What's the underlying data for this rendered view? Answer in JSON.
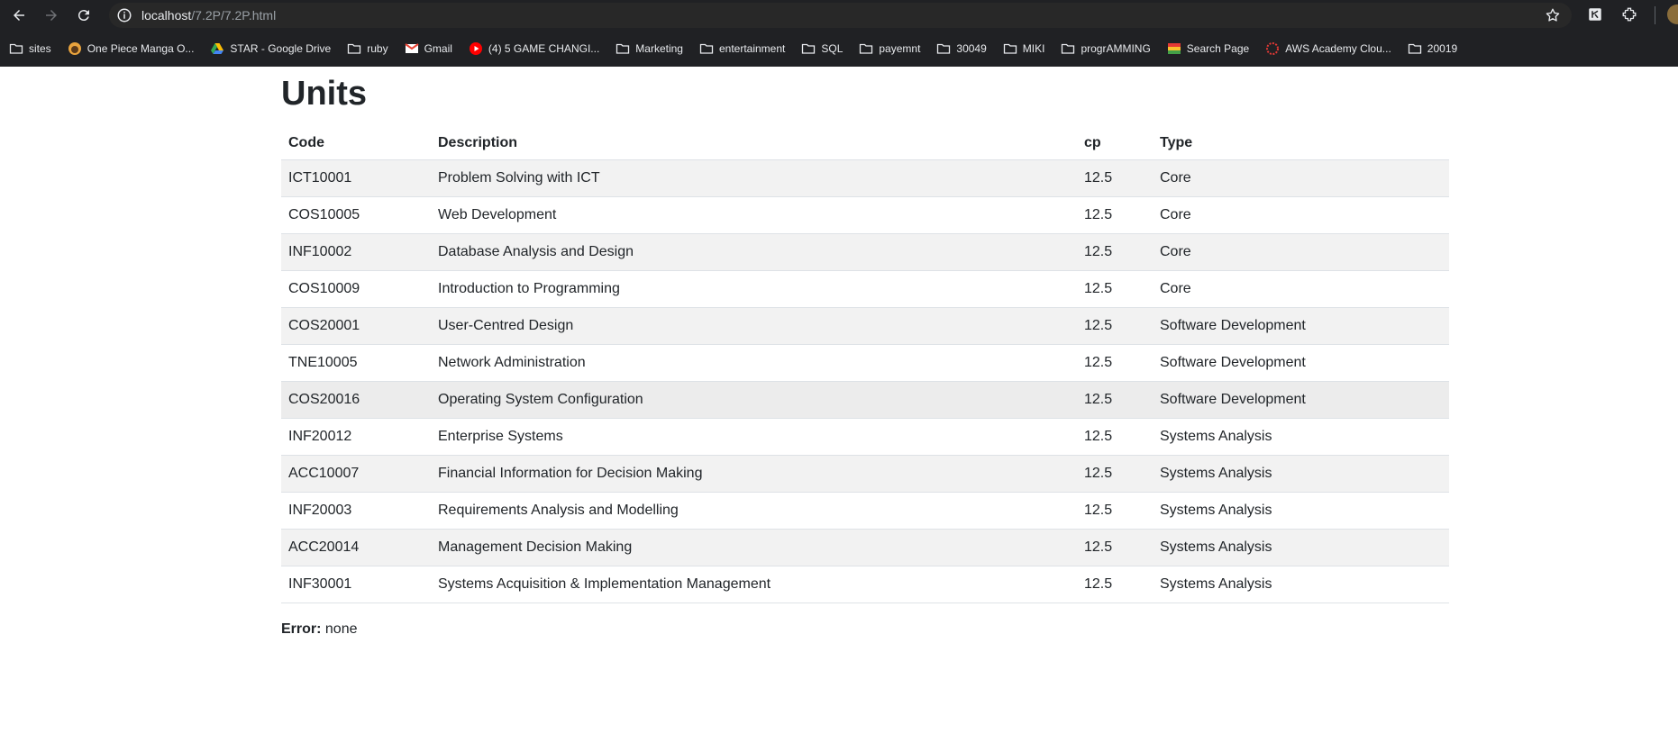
{
  "browser": {
    "url_host": "localhost",
    "url_path": "/7.2P/7.2P.html",
    "bookmarks": [
      {
        "label": "sites",
        "icon": "folder-icon"
      },
      {
        "label": "One Piece Manga O...",
        "icon": "manga-favicon"
      },
      {
        "label": "STAR - Google Drive",
        "icon": "google-drive-icon"
      },
      {
        "label": "ruby",
        "icon": "folder-icon"
      },
      {
        "label": "Gmail",
        "icon": "gmail-icon"
      },
      {
        "label": "(4) 5 GAME CHANGI...",
        "icon": "youtube-icon"
      },
      {
        "label": "Marketing",
        "icon": "folder-icon"
      },
      {
        "label": "entertainment",
        "icon": "folder-icon"
      },
      {
        "label": "SQL",
        "icon": "folder-icon"
      },
      {
        "label": "payemnt",
        "icon": "folder-icon"
      },
      {
        "label": "30049",
        "icon": "folder-icon"
      },
      {
        "label": "MIKI",
        "icon": "folder-icon"
      },
      {
        "label": "progrAMMING",
        "icon": "folder-icon"
      },
      {
        "label": "Search Page",
        "icon": "search-page-favicon"
      },
      {
        "label": "AWS Academy Clou...",
        "icon": "aws-favicon"
      },
      {
        "label": "20019",
        "icon": "folder-icon"
      }
    ]
  },
  "page": {
    "title": "Units",
    "headers": {
      "code": "Code",
      "description": "Description",
      "cp": "cp",
      "type": "Type"
    },
    "rows": [
      {
        "code": "ICT10001",
        "description": "Problem Solving with ICT",
        "cp": "12.5",
        "type": "Core"
      },
      {
        "code": "COS10005",
        "description": "Web Development",
        "cp": "12.5",
        "type": "Core"
      },
      {
        "code": "INF10002",
        "description": "Database Analysis and Design",
        "cp": "12.5",
        "type": "Core"
      },
      {
        "code": "COS10009",
        "description": "Introduction to Programming",
        "cp": "12.5",
        "type": "Core"
      },
      {
        "code": "COS20001",
        "description": "User-Centred Design",
        "cp": "12.5",
        "type": "Software Development"
      },
      {
        "code": "TNE10005",
        "description": "Network Administration",
        "cp": "12.5",
        "type": "Software Development"
      },
      {
        "code": "COS20016",
        "description": "Operating System Configuration",
        "cp": "12.5",
        "type": "Software Development"
      },
      {
        "code": "INF20012",
        "description": "Enterprise Systems",
        "cp": "12.5",
        "type": "Systems Analysis"
      },
      {
        "code": "ACC10007",
        "description": "Financial Information for Decision Making",
        "cp": "12.5",
        "type": "Systems Analysis"
      },
      {
        "code": "INF20003",
        "description": "Requirements Analysis and Modelling",
        "cp": "12.5",
        "type": "Systems Analysis"
      },
      {
        "code": "ACC20014",
        "description": "Management Decision Making",
        "cp": "12.5",
        "type": "Systems Analysis"
      },
      {
        "code": "INF30001",
        "description": "Systems Acquisition & Implementation Management",
        "cp": "12.5",
        "type": "Systems Analysis"
      }
    ],
    "error_label": "Error:",
    "error_value": "none"
  }
}
